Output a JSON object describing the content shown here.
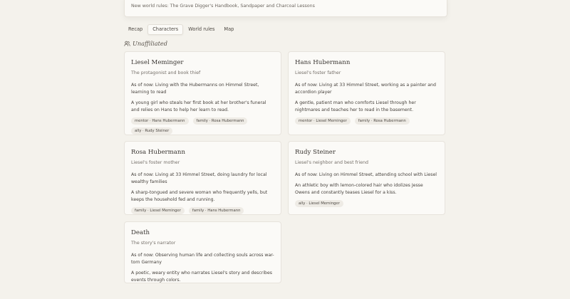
{
  "world_rules": "New world rules: The Grave Digger's Handbook, Sandpaper and Charcoal Lessons",
  "tabs": [
    {
      "label": "Recap",
      "active": false
    },
    {
      "label": "Characters",
      "active": true
    },
    {
      "label": "World rules",
      "active": false
    },
    {
      "label": "Map",
      "active": false
    }
  ],
  "group": {
    "title": "Unaffiliated",
    "icon": "people-icon"
  },
  "characters": [
    {
      "name": "Liesel Meminger",
      "role": "The protagonist and book thief",
      "status": "As of now: Living with the Hubermanns on Himmel Street, learning to read",
      "description": "A young girl who steals her first book at her brother's funeral and relies on Hans to help her learn to read.",
      "tags": [
        "mentor · Hans Hubermann",
        "family · Rosa Hubermann",
        "ally · Rudy Steiner"
      ]
    },
    {
      "name": "Hans Hubermann",
      "role": "Liesel's foster father",
      "status": "As of now: Living at 33 Himmel Street, working as a painter and accordion player",
      "description": "A gentle, patient man who comforts Liesel through her nightmares and teaches her to read in the basement.",
      "tags": [
        "mentor · Liesel Meminger",
        "family · Rosa Hubermann"
      ]
    },
    {
      "name": "Rosa Hubermann",
      "role": "Liesel's foster mother",
      "status": "As of now: Living at 33 Himmel Street, doing laundry for local wealthy families",
      "description": "A sharp-tongued and severe woman who frequently yells, but keeps the household fed and running.",
      "tags": [
        "family · Liesel Meminger",
        "family · Hans Hubermann"
      ]
    },
    {
      "name": "Rudy Steiner",
      "role": "Liesel's neighbor and best friend",
      "status": "As of now: Living on Himmel Street, attending school with Liesel",
      "description": "An athletic boy with lemon-colored hair who idolizes Jesse Owens and constantly teases Liesel for a kiss.",
      "tags": [
        "ally · Liesel Meminger"
      ]
    },
    {
      "name": "Death",
      "role": "The story's narrator",
      "status": "As of now: Observing human life and collecting souls across war-torn Germany",
      "description": "A poetic, weary entity who narrates Liesel's story and describes events through colors.",
      "tags": []
    }
  ]
}
